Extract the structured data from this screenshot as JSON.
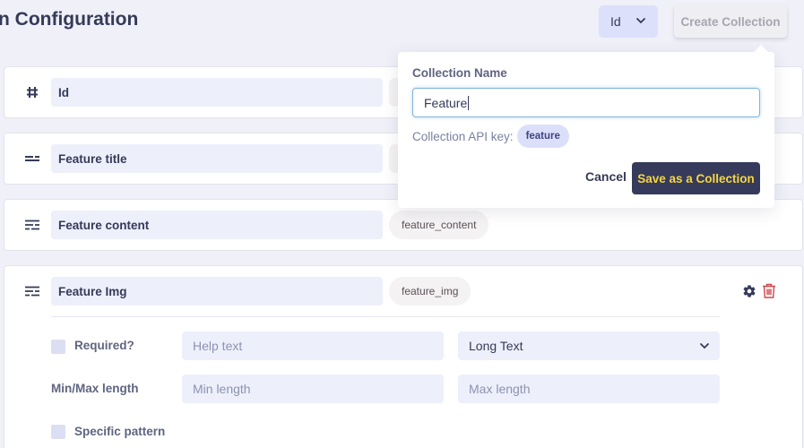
{
  "header": {
    "title": "n Configuration",
    "id_select": {
      "value": "Id"
    },
    "create_collection_label": "Create Collection"
  },
  "fields": [
    {
      "icon": "hash-icon",
      "name": "Id",
      "api_key": ""
    },
    {
      "icon": "short-text-icon",
      "name": "Feature title",
      "api_key": ""
    },
    {
      "icon": "long-text-icon",
      "name": "Feature content",
      "api_key": "feature_content"
    },
    {
      "icon": "long-text-icon",
      "name": "Feature Img",
      "api_key": "feature_img"
    }
  ],
  "expanded_field": {
    "required_label": "Required?",
    "help_text_placeholder": "Help text",
    "type_select_value": "Long Text",
    "min_max_label": "Min/Max length",
    "min_placeholder": "Min length",
    "max_placeholder": "Max length",
    "specific_pattern_label": "Specific pattern",
    "settings_icon": "gear-icon",
    "delete_icon": "trash-icon"
  },
  "popover": {
    "label": "Collection Name",
    "input_value": "Feature",
    "api_key_label": "Collection API key:",
    "api_key_value": "feature",
    "cancel_label": "Cancel",
    "save_label": "Save as a Collection"
  },
  "colors": {
    "background": "#eff0f8",
    "primary_dark": "#363b5c",
    "accent_yellow": "#f7d63d",
    "input_bg": "#edeffb",
    "delete_red": "#d0454c"
  }
}
